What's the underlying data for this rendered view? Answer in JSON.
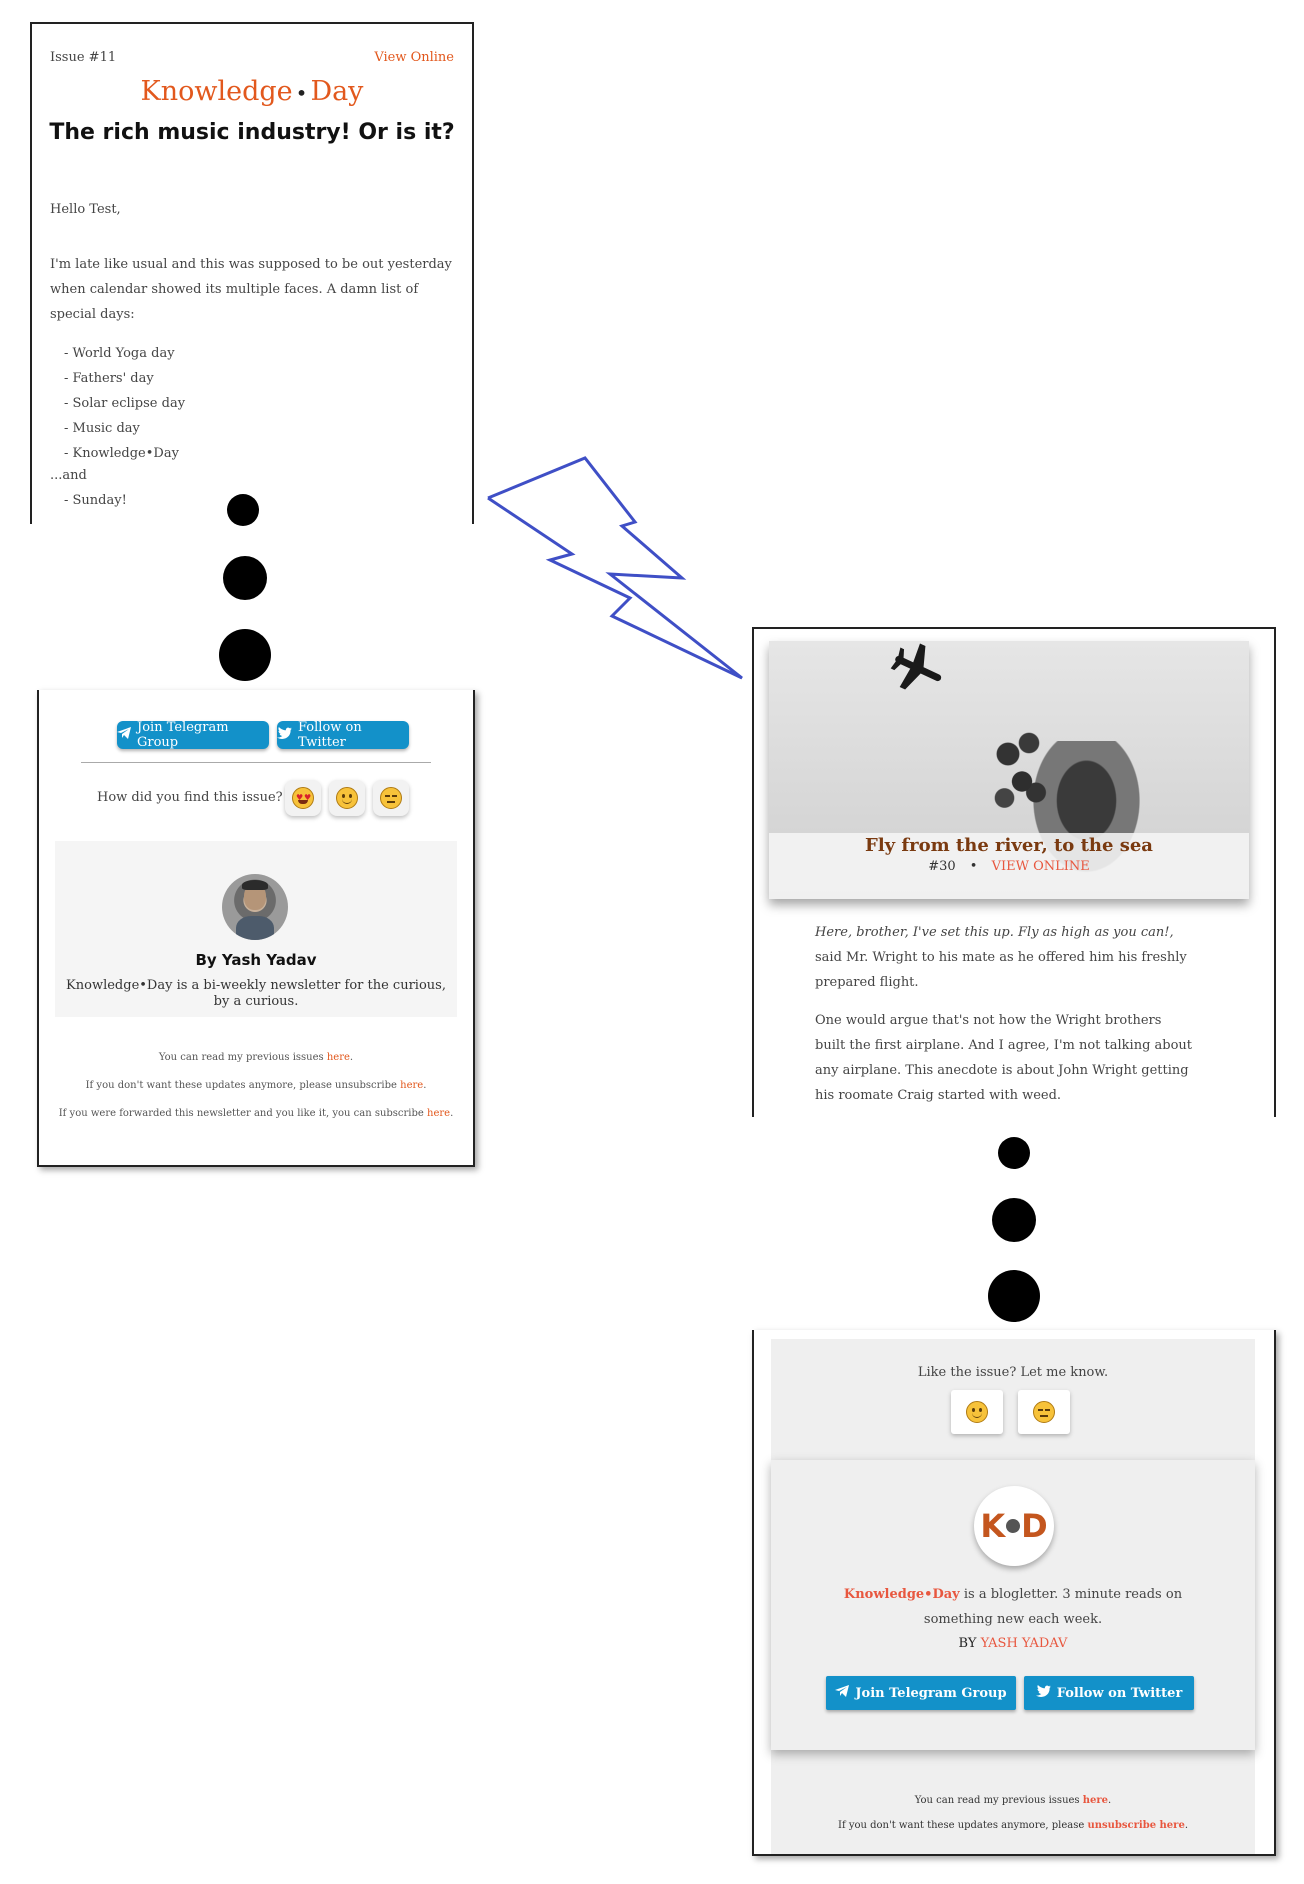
{
  "left_email": {
    "issue_label": "Issue #11",
    "view_online": "View Online",
    "brand_left": "Knowledge",
    "brand_sep": "•",
    "brand_right": "Day",
    "headline": "The rich music industry! Or is it?",
    "greeting": "Hello Test,",
    "intro": "I'm late like usual and this was supposed to be out yesterday when calendar showed its multiple faces. A damn list of special days:",
    "list": [
      "- World Yoga day",
      "- Fathers' day",
      "- Solar eclipse day",
      "- Music day",
      "- Knowledge•Day"
    ],
    "and_text": "...and",
    "sunday": "- Sunday!",
    "telegram_button": "Join Telegram Group",
    "twitter_button": "Follow on Twitter",
    "feedback_question": "How did you find this issue?",
    "author_name": "By Yash Yadav",
    "author_desc": "Knowledge•Day is a bi-weekly newsletter for the curious, by a curious.",
    "footer": {
      "previous": "You can read my previous issues",
      "unsubscribe": "If you don't want these updates anymore, please unsubscribe",
      "forwarded": "If you were forwarded this newsletter and you like it, you can subscribe",
      "here": "here",
      "period": "."
    }
  },
  "right_email": {
    "hero_title": "Fly from the river, to the sea",
    "hero_issue": "#30",
    "hero_sep": "•",
    "hero_view_online": "VIEW ONLINE",
    "quote_italic": "Here, brother, I've set this up. Fly as high as you can!,",
    "quote_rest": " said Mr. Wright to his mate as he offered him his freshly prepared flight.",
    "paragraph2": "One would argue that's not how the Wright brothers built the first airplane. And I agree, I'm not talking about any airplane. This anecdote is about John Wright getting his roomate Craig started with weed.",
    "like_prompt": "Like the issue? Let me know.",
    "logo_k": "K",
    "logo_d": "D",
    "brand_name": "Knowledge•Day",
    "brand_desc": " is a blogletter. 3 minute reads on something new each week.",
    "by_label": "BY ",
    "by_name": "YASH YADAV",
    "telegram_button": "Join Telegram Group",
    "twitter_button": "Follow on Twitter",
    "footer": {
      "previous": "You can read my previous issues",
      "unsubscribe": "If you don't want these updates anymore, please",
      "here": "here",
      "unsubscribe_link": "unsubscribe here",
      "period": "."
    }
  },
  "colors": {
    "accent_orange": "#e2581d",
    "accent_red": "#e8573f",
    "button_blue": "#1391c9",
    "connector_blue": "#3f4fc6"
  }
}
